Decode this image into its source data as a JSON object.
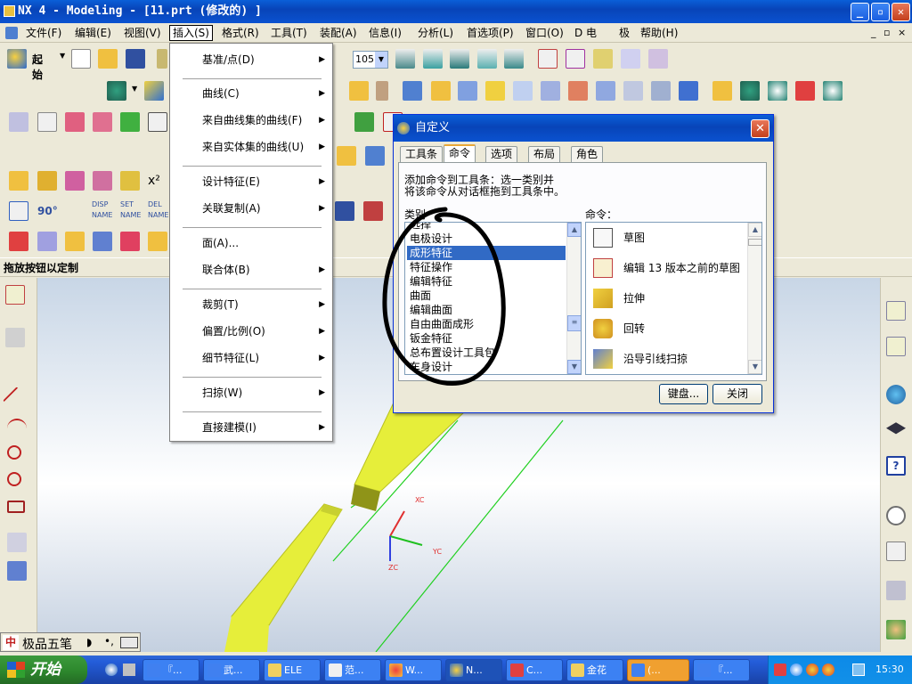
{
  "window": {
    "title": "NX 4 - Modeling - [11.prt  (修改的) ]",
    "min": "_",
    "max": "▫",
    "close": "✕"
  },
  "menubar": {
    "items": [
      "文件(F)",
      "编辑(E)",
      "视图(V)",
      "插入(S)",
      "格式(R)",
      "工具(T)",
      "装配(A)",
      "信息(I)",
      "分析(L)",
      "首选项(P)",
      "窗口(O)",
      "D 电",
      "极",
      "帮助(H)"
    ],
    "active_index": 3,
    "mdi": [
      "_",
      "▫",
      "×"
    ]
  },
  "toolbar": {
    "start_label": "起始",
    "zoom_value": "105"
  },
  "prompt": "拖放按钮以定制",
  "insert_menu": {
    "items": [
      {
        "label": "基准/点(D)",
        "submenu": true
      },
      {
        "label": "曲线(C)",
        "submenu": true
      },
      {
        "label": "来自曲线集的曲线(F)",
        "submenu": true
      },
      {
        "label": "来自实体集的曲线(U)",
        "submenu": true
      },
      {
        "label": "设计特征(E)",
        "submenu": true
      },
      {
        "label": "关联复制(A)",
        "submenu": true
      },
      {
        "label": "面(A)...",
        "submenu": false
      },
      {
        "label": "联合体(B)",
        "submenu": true
      },
      {
        "label": "裁剪(T)",
        "submenu": true
      },
      {
        "label": "偏置/比例(O)",
        "submenu": true
      },
      {
        "label": "细节特征(L)",
        "submenu": true
      },
      {
        "label": "扫掠(W)",
        "submenu": true
      },
      {
        "label": "直接建模(I)",
        "submenu": true
      }
    ]
  },
  "dialog": {
    "title": "自定义",
    "tabs": [
      "工具条",
      "命令",
      "选项",
      "布局",
      "角色"
    ],
    "active_tab": 1,
    "instruction_line1": "添加命令到工具条：选一类别并",
    "instruction_line2": "将该命令从对话框拖到工具条中。",
    "category_label": "类别",
    "command_label": "命令：",
    "categories": [
      "选择",
      "电极设计",
      "成形特征",
      "特征操作",
      "编辑特征",
      "曲面",
      "编辑曲面",
      "自由曲面成形",
      "钣金特征",
      "总布置设计工具包",
      "车身设计"
    ],
    "selected_category": 2,
    "commands": [
      "草图",
      "编辑 13 版本之前的草图",
      "拉伸",
      "回转",
      "沿导引线扫掠"
    ],
    "keyboard_button": "键盘...",
    "close_button": "关闭"
  },
  "viewport": {
    "axis_xc": "XC",
    "axis_yc": "YC",
    "axis_zc": "ZC"
  },
  "ime": {
    "label": "极品五笔"
  },
  "taskbar": {
    "start_label": "开始",
    "tasks": [
      "『...",
      "武...",
      "ELE",
      "范...",
      "W...",
      "N...",
      "C...",
      "金花",
      "(...",
      "『..."
    ],
    "active_task": 5,
    "clock": "15:30"
  },
  "colors": {
    "accent": "#0a52d0",
    "selection": "#316ac5",
    "part_yellow": "#e6ee3a",
    "annotation": "#000000"
  }
}
